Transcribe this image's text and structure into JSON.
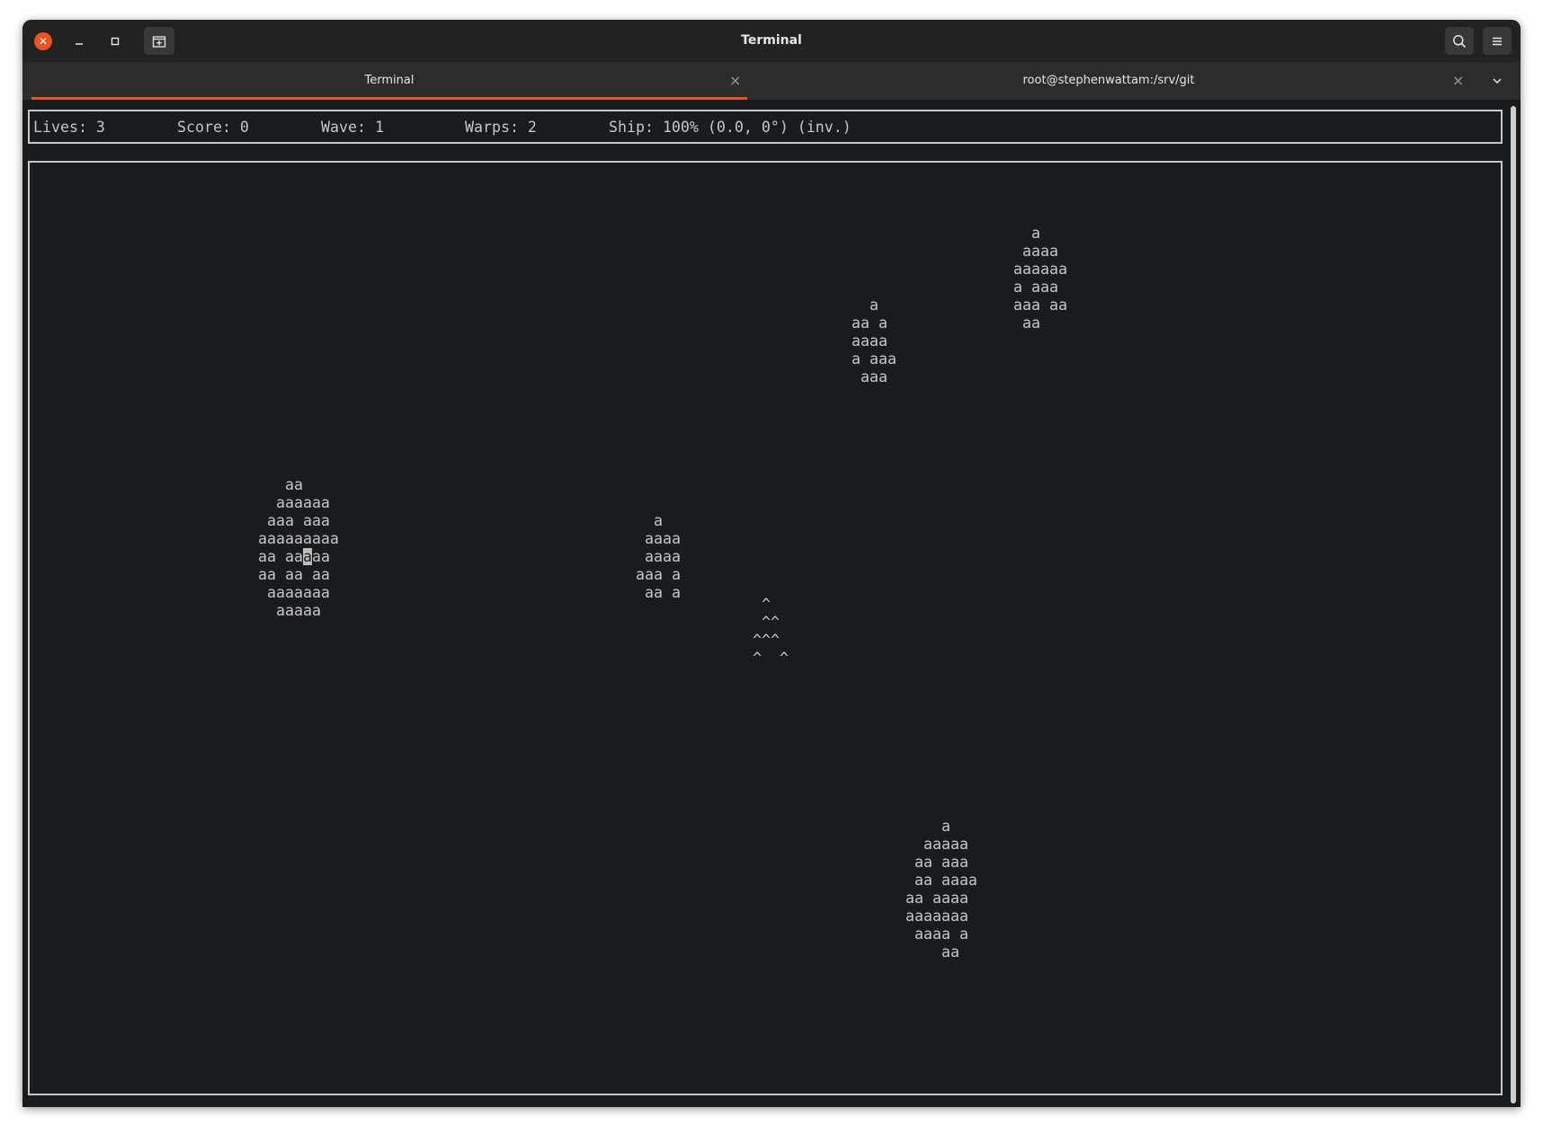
{
  "window": {
    "title": "Terminal",
    "accent_color": "#e95420",
    "buttons": [
      "close-icon",
      "minimize-icon",
      "maximize-icon",
      "new-tab-icon",
      "search-icon",
      "hamburger-menu-icon"
    ]
  },
  "tabs": [
    {
      "label": "Terminal",
      "active": true
    },
    {
      "label": "root@stephenwattam:/srv/git",
      "active": false
    }
  ],
  "status": {
    "lives": "Lives: 3",
    "score": "Score: 0",
    "wave": "Wave: 1",
    "warps": "Warps: 2",
    "ship": "Ship: 100% (0.0, 0°) (inv.)"
  },
  "game": {
    "asteroid_top_right": "  a\n aaaa\naaaaaa\na aaa\naaa aa\n aa",
    "asteroid_upper_mid": "  a\naa a\naaaa\na aaa\n aaa",
    "asteroid_left_pre": "   aa\n  aaaaaa\n aaa aaa\naaaaaaaaa\naa aa",
    "asteroid_left_cursor": "a",
    "asteroid_left_post": "aa\naa aa aa\n aaaaaaa\n  aaaaa",
    "asteroid_center": "   a\n  aaaa\n  aaaa\n aaa a\n  aa a",
    "ship": " ^\n ^^\n^^^\n^  ^",
    "asteroid_bottom": "    a\n  aaaaa\n aa aaa\n aa aaaa\naa aaaa\naaaaaaa\n aaaa a\n    aa"
  }
}
